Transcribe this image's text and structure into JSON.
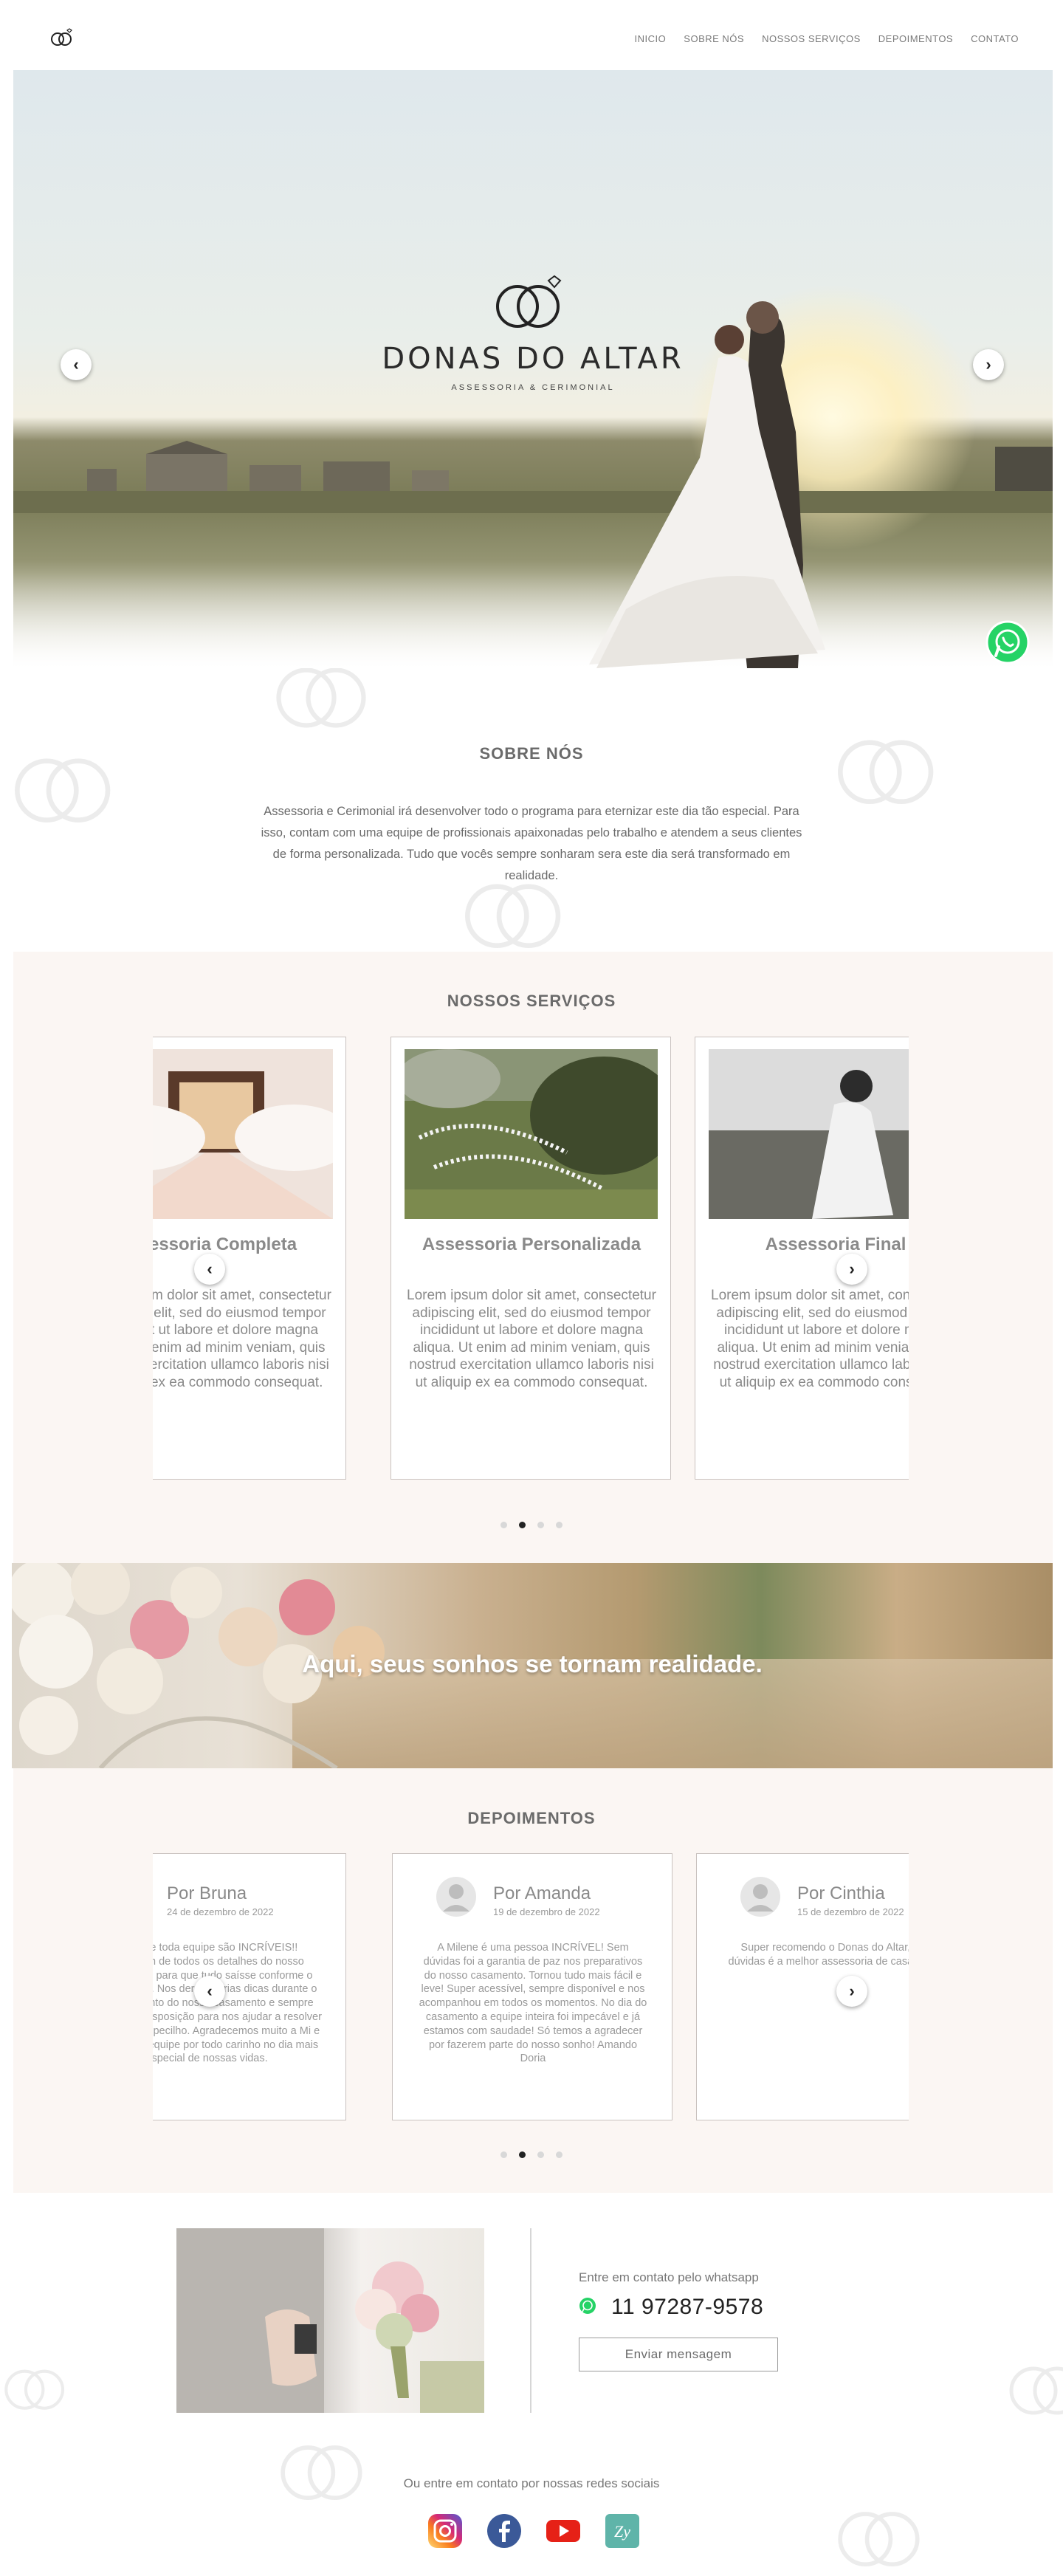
{
  "nav": {
    "items": [
      "INICIO",
      "SOBRE NÓS",
      "NOSSOS SERVIÇOS",
      "DEPOIMENTOS",
      "CONTATO"
    ]
  },
  "hero": {
    "brand_name": "DONAS DO ALTAR",
    "brand_sub": "ASSESSORIA & CERIMONIAL"
  },
  "sobre": {
    "title": "SOBRE NÓS",
    "text": "Assessoria e Cerimonial irá desenvolver todo o programa para eternizar este dia tão especial. Para isso, contam com uma equipe de profissionais apaixonadas pelo trabalho e atendem a seus clientes de forma personalizada. Tudo que vocês sempre sonharam sera este dia será transformado em realidade."
  },
  "servicos": {
    "title": "NOSSOS SERVIÇOS",
    "cards": [
      {
        "title": "Assessoria Completa",
        "text": "Lorem ipsum dolor sit amet, consectetur adipiscing elit, sed do eiusmod tempor incididunt ut labore et dolore magna aliqua. Ut enim ad minim veniam, quis nostrud exercitation ullamco laboris nisi ut aliquip ex ea commodo consequat."
      },
      {
        "title": "Assessoria Personalizada",
        "text": "Lorem ipsum dolor sit amet, consectetur adipiscing elit, sed do eiusmod tempor incididunt ut labore et dolore magna aliqua. Ut enim ad minim veniam, quis nostrud exercitation ullamco laboris nisi ut aliquip ex ea commodo consequat."
      },
      {
        "title": "Assessoria Final",
        "text": "Lorem ipsum dolor sit amet, consectetur adipiscing elit, sed do eiusmod tempor incididunt ut labore et dolore magna aliqua. Ut enim ad minim veniam, quis nostrud exercitation ullamco laboris nisi ut aliquip ex ea commodo consequat."
      }
    ]
  },
  "banner": {
    "text": "Aqui, seus sonhos se tornam realidade."
  },
  "depoimentos": {
    "title": "DEPOIMENTOS",
    "cards": [
      {
        "name": "Por Bruna",
        "date": "24 de dezembro de 2022",
        "text": "Milene e toda equipe são INCRÍVEIS!! Cuidaram de todos os detalhes do nosso casamento para que tudo saísse conforme o planejamos. Nos deram várias dicas durante o planejamento do nosso casamento e sempre estavam a disposição para nos ajudar a resolver qualquer empecilho. Agradecemos muito a Mi e a toda sua equipe por todo carinho no dia mais especial de nossas vidas."
      },
      {
        "name": "Por Amanda",
        "date": "19 de dezembro de 2022",
        "text": "A Milene é uma pessoa INCRÍVEL! Sem dúvidas foi a garantia de paz nos preparativos do nosso casamento. Tornou tudo mais fácil e leve! Super acessível, sempre disponível e nos acompanhou em todos os momentos. No dia do casamento a equipe inteira foi impecável e já estamos com saudade! Só temos a agradecer por fazerem parte do nosso sonho! Amando Doria"
      },
      {
        "name": "Por Cinthia",
        "date": "15 de dezembro de 2022",
        "text": "Super recomendo o Donas do Altar, sem dúvidas é a melhor assessoria de casamento."
      }
    ]
  },
  "contato": {
    "label": "Entre em contato pelo whatsapp",
    "phone": "11 97287-9578",
    "button": "Enviar mensagem",
    "social_label": "Ou entre em contato por nossas redes sociais",
    "social_icons": [
      "instagram-icon",
      "facebook-icon",
      "youtube-icon",
      "zankyou-icon"
    ]
  },
  "colors": {
    "section_bg": "#fbf6f3",
    "whatsapp": "#25d366",
    "facebook": "#3b5998",
    "youtube": "#e62117",
    "zankyou": "#5fb4a9"
  }
}
